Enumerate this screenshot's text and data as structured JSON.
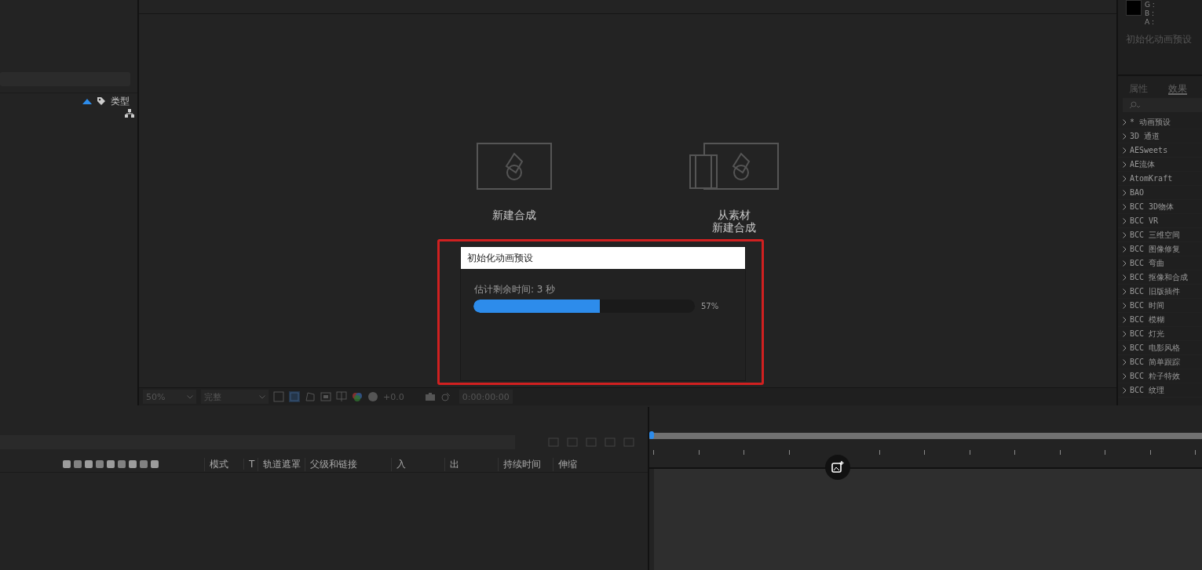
{
  "project_panel": {
    "sort_column": "类型"
  },
  "viewer": {
    "start_options": [
      {
        "kind": "composition",
        "lines": [
          "新建合成"
        ]
      },
      {
        "kind": "footage",
        "lines": [
          "从素材",
          "新建合成"
        ]
      }
    ],
    "dialog": {
      "title": "初始化动画预设",
      "message": "估计剩余时间: 3 秒",
      "level": 0.57,
      "percent": "57%"
    },
    "toolbar": {
      "zoom": "50%",
      "resolution": "完整",
      "exposure": "+0.0",
      "timecode": "0:00:00:00"
    }
  },
  "info_panel": {
    "channels": [
      "G :",
      "B :",
      "A :"
    ],
    "status": "初始化动画预设"
  },
  "effects_panel": {
    "tabs": [
      {
        "label": "属性",
        "selected": false
      },
      {
        "label": "效果",
        "selected": true
      }
    ],
    "items": [
      "* 动画预设",
      "3D 通道",
      "AESweets",
      "AE流体",
      "AtomKraft",
      "BAO",
      "BCC 3D物体",
      "BCC VR",
      "BCC 三维空间",
      "BCC 图像修复",
      "BCC 弯曲",
      "BCC 抠像和合成",
      "BCC 旧版插件",
      "BCC 时间",
      "BCC 模糊",
      "BCC 灯光",
      "BCC 电影风格",
      "BCC 简单跟踪",
      "BCC 粒子特效",
      "BCC 纹理"
    ]
  },
  "timeline": {
    "columns": [
      "模式",
      "T",
      "轨道遮罩",
      "父级和链接",
      "入",
      "出",
      "持续时间",
      "伸缩"
    ]
  }
}
